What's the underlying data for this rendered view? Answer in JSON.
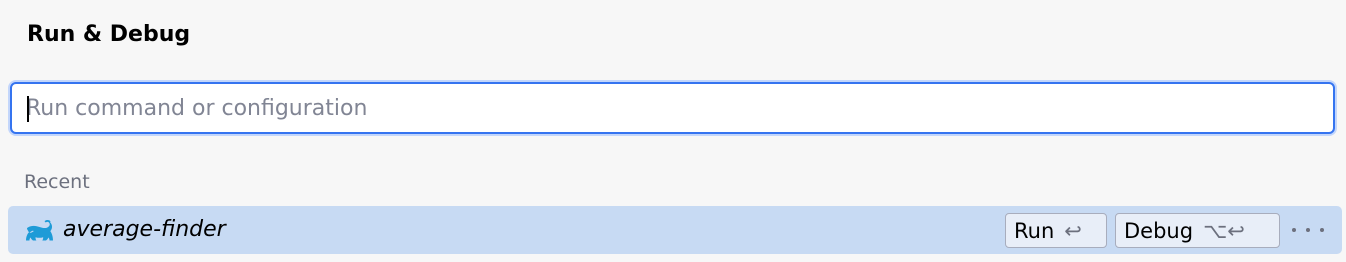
{
  "panel": {
    "title": "Run & Debug"
  },
  "search": {
    "placeholder": "Run command or configuration",
    "value": ""
  },
  "recent": {
    "label": "Recent",
    "items": [
      {
        "name": "average-finder",
        "icon": "gradle-elephant-icon",
        "icon_color": "#1e9bd7",
        "actions": [
          {
            "label": "Run",
            "shortcut": "↩"
          },
          {
            "label": "Debug",
            "shortcut": "⌥↩"
          }
        ]
      }
    ]
  },
  "colors": {
    "accent": "#3574f0",
    "selected_row": "#c7daf3"
  }
}
